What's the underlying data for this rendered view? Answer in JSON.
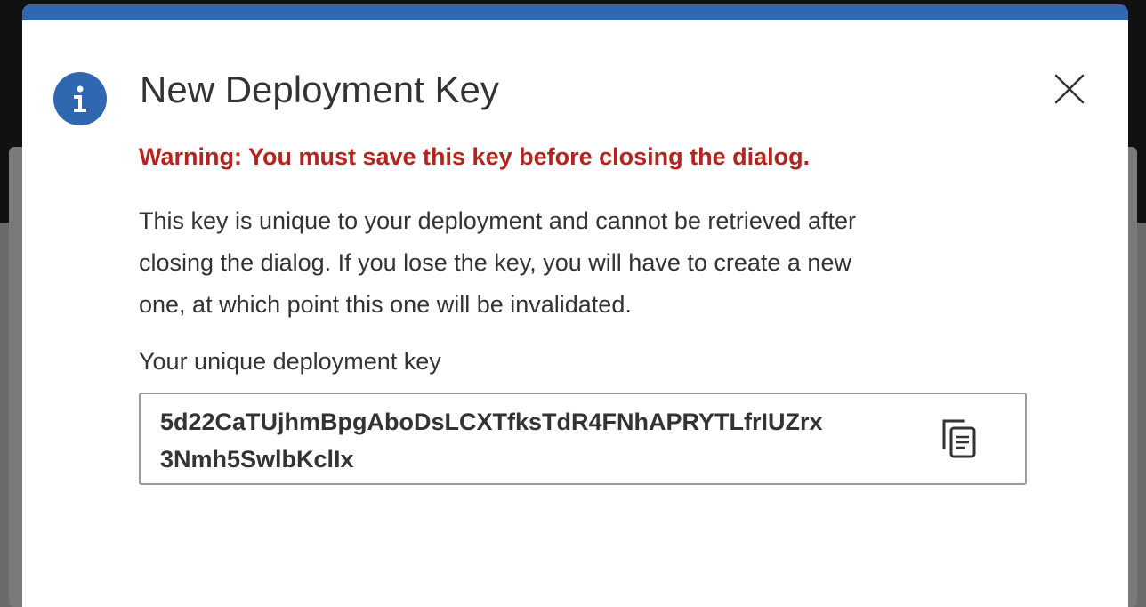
{
  "dialog": {
    "title": "New Deployment Key",
    "warning": "Warning: You must save this key before closing the dialog.",
    "description_lines": [
      "This key is unique to your deployment and cannot be retrieved after",
      "closing the dialog. If you lose the key, you will have to create a new",
      "one, at which point this one will be invalidated."
    ],
    "key_label": "Your unique deployment key",
    "key_value_lines": [
      "5d22CaTUjhmBpgAboDsLCXTfksTdR4FNhAPRYTLfrIUZrx",
      "3Nmh5SwlbKclIx"
    ]
  },
  "icons": {
    "info": "info-icon",
    "close": "close-icon",
    "copy": "copy-icon"
  },
  "colors": {
    "accent": "#2f67b1",
    "warning": "#b3241c",
    "text": "#333333",
    "dialog_bg": "#ffffff"
  }
}
